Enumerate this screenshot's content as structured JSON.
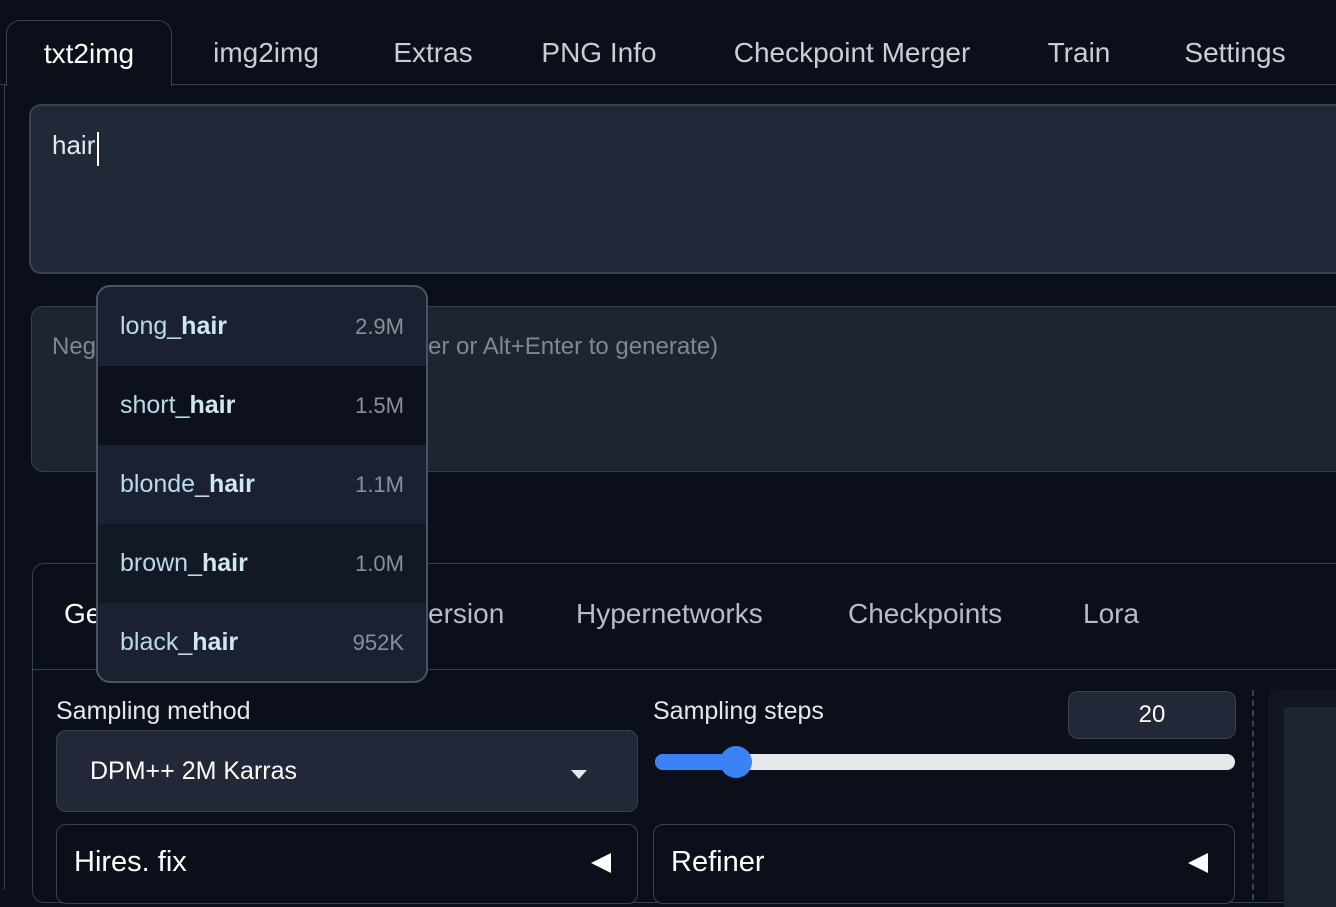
{
  "top_tabs": [
    "txt2img",
    "img2img",
    "Extras",
    "PNG Info",
    "Checkpoint Merger",
    "Train",
    "Settings"
  ],
  "prompt": {
    "value": "hair"
  },
  "negative_prompt": {
    "placeholder_visible": "Neg",
    "placeholder_tail": "er or Alt+Enter to generate)"
  },
  "autocomplete": {
    "items": [
      {
        "prefix": "long_",
        "match": "hair",
        "count": "2.9M"
      },
      {
        "prefix": "short_",
        "match": "hair",
        "count": "1.5M"
      },
      {
        "prefix": "blonde_",
        "match": "hair",
        "count": "1.1M"
      },
      {
        "prefix": "brown_",
        "match": "hair",
        "count": "1.0M"
      },
      {
        "prefix": "black_",
        "match": "hair",
        "count": "952K"
      }
    ]
  },
  "sub_tabs": [
    "Ge",
    "ersion",
    "Hypernetworks",
    "Checkpoints",
    "Lora"
  ],
  "sampling": {
    "method_label": "Sampling method",
    "method_value": "DPM++ 2M Karras",
    "steps_label": "Sampling steps",
    "steps_value": "20",
    "steps_fraction": 0.14
  },
  "accordions": {
    "hires": "Hires. fix",
    "refiner": "Refiner"
  },
  "colors": {
    "accent": "#3b82f6",
    "background": "#0b0f19",
    "panel": "#222838"
  }
}
